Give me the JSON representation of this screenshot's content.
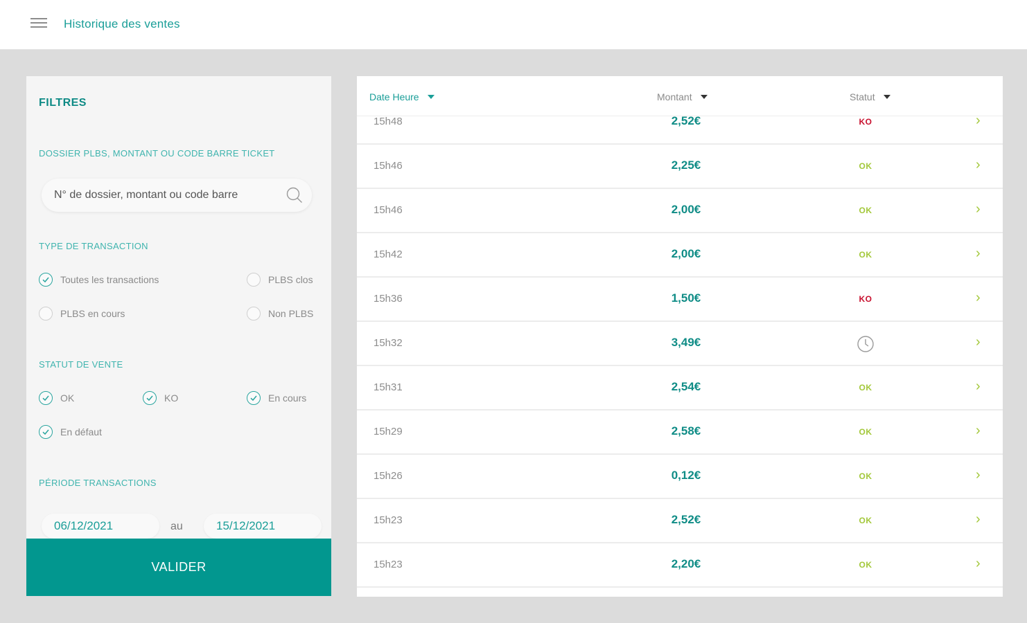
{
  "header": {
    "title": "Historique des ventes"
  },
  "filters": {
    "title": "FILTRES",
    "search": {
      "label": "DOSSIER PLBS, MONTANT OU CODE BARRE TICKET",
      "placeholder": "N° de dossier, montant ou code barre"
    },
    "transaction_type": {
      "label": "TYPE DE TRANSACTION",
      "options": [
        {
          "label": "Toutes les transactions",
          "checked": true
        },
        {
          "label": "PLBS clos",
          "checked": false
        },
        {
          "label": "PLBS en cours",
          "checked": false
        },
        {
          "label": "Non PLBS",
          "checked": false
        }
      ]
    },
    "sale_status": {
      "label": "STATUT DE VENTE",
      "options": [
        {
          "label": "OK",
          "checked": true
        },
        {
          "label": "KO",
          "checked": true
        },
        {
          "label": "En cours",
          "checked": true
        },
        {
          "label": "En défaut",
          "checked": true
        }
      ]
    },
    "period": {
      "label": "PÉRIODE TRANSACTIONS",
      "from": "06/12/2021",
      "separator": "au",
      "to": "15/12/2021"
    },
    "validate_label": "VALIDER"
  },
  "table": {
    "columns": [
      {
        "label": "Date Heure",
        "active": true
      },
      {
        "label": "Montant",
        "active": false
      },
      {
        "label": "Statut",
        "active": false
      }
    ],
    "rows": [
      {
        "time": "15h48",
        "amount": "2,52€",
        "status": "KO"
      },
      {
        "time": "15h46",
        "amount": "2,25€",
        "status": "OK"
      },
      {
        "time": "15h46",
        "amount": "2,00€",
        "status": "OK"
      },
      {
        "time": "15h42",
        "amount": "2,00€",
        "status": "OK"
      },
      {
        "time": "15h36",
        "amount": "1,50€",
        "status": "KO"
      },
      {
        "time": "15h32",
        "amount": "3,49€",
        "status": "clock-icon"
      },
      {
        "time": "15h31",
        "amount": "2,54€",
        "status": "OK"
      },
      {
        "time": "15h29",
        "amount": "2,58€",
        "status": "OK"
      },
      {
        "time": "15h26",
        "amount": "0,12€",
        "status": "OK"
      },
      {
        "time": "15h23",
        "amount": "2,52€",
        "status": "OK"
      },
      {
        "time": "15h23",
        "amount": "2,20€",
        "status": "OK"
      }
    ],
    "chevron": "›"
  },
  "colors": {
    "accent": "#02978f",
    "ok": "#a3c83a",
    "ko": "#c8102e"
  }
}
